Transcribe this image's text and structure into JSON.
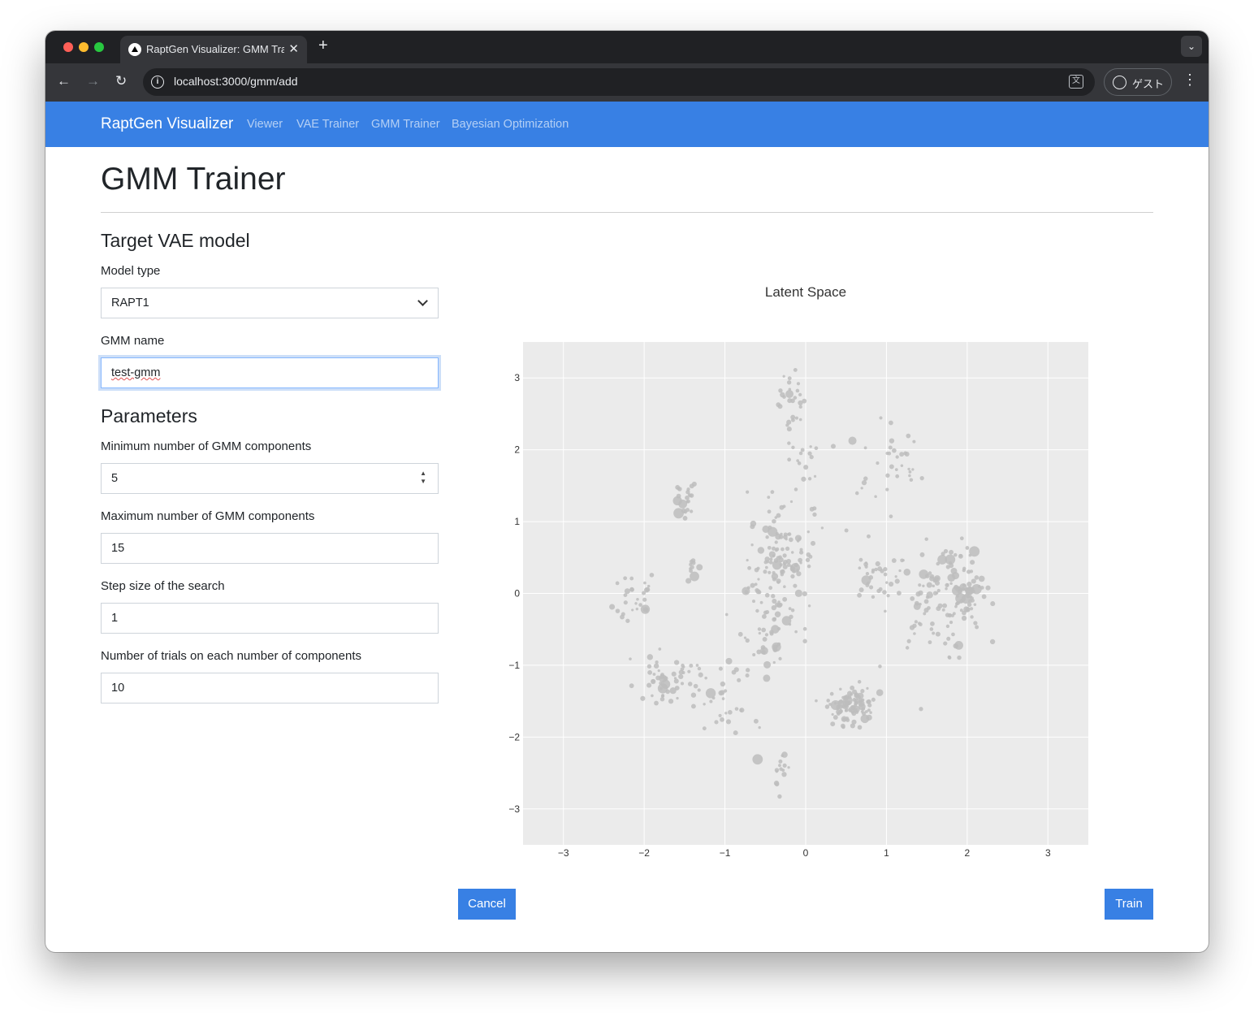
{
  "browser": {
    "tab_title": "RaptGen Visualizer: GMM Trainer",
    "new_tab": "+",
    "tab_close": "✕",
    "url": "localhost:3000/gmm/add",
    "profile_label": "ゲスト"
  },
  "navbar": {
    "brand": "RaptGen Visualizer",
    "links": [
      "Viewer",
      "VAE Trainer",
      "GMM Trainer",
      "Bayesian Optimization"
    ]
  },
  "page": {
    "title": "GMM Trainer",
    "target_section": "Target VAE model",
    "model_type_label": "Model type",
    "model_type_value": "RAPT1",
    "gmm_name_label": "GMM name",
    "gmm_name_value": "test-gmm",
    "params_section": "Parameters",
    "min_label": "Minimum number of GMM components",
    "min_value": "5",
    "max_label": "Maximum number of GMM components",
    "max_value": "15",
    "step_label": "Step size of the search",
    "step_value": "1",
    "trials_label": "Number of trials on each number of components",
    "trials_value": "10"
  },
  "actions": {
    "cancel": "Cancel",
    "train": "Train"
  },
  "colors": {
    "navbar": "#3880e4",
    "button": "#3880e4",
    "plot_bg": "#ebebeb",
    "point": "#bdbdbd"
  },
  "chart_data": {
    "type": "scatter",
    "title": "Latent Space",
    "xlabel": "",
    "ylabel": "",
    "xlim": [
      -3.5,
      3.5
    ],
    "ylim": [
      -3.5,
      3.5
    ],
    "xticks": [
      -3,
      -2,
      -1,
      0,
      1,
      2,
      3
    ],
    "yticks": [
      -3,
      -2,
      -1,
      0,
      1,
      2,
      3
    ],
    "grid": true,
    "clusters": [
      {
        "cx": -0.18,
        "cy": 2.65,
        "sx": 0.08,
        "sy": 0.3,
        "n": 30
      },
      {
        "cx": -0.02,
        "cy": 1.9,
        "sx": 0.1,
        "sy": 0.15,
        "n": 10
      },
      {
        "cx": 1.15,
        "cy": 1.75,
        "sx": 0.15,
        "sy": 0.25,
        "n": 25
      },
      {
        "cx": 0.6,
        "cy": 1.5,
        "sx": 0.35,
        "sy": 0.5,
        "n": 18
      },
      {
        "cx": -1.5,
        "cy": 1.3,
        "sx": 0.08,
        "sy": 0.15,
        "n": 22
      },
      {
        "cx": -0.3,
        "cy": 0.4,
        "sx": 0.2,
        "sy": 0.45,
        "n": 130
      },
      {
        "cx": -0.5,
        "cy": -0.55,
        "sx": 0.15,
        "sy": 0.3,
        "n": 35
      },
      {
        "cx": 0.8,
        "cy": 0.2,
        "sx": 0.15,
        "sy": 0.15,
        "n": 25
      },
      {
        "cx": 1.6,
        "cy": 0.0,
        "sx": 0.3,
        "sy": 0.4,
        "n": 110
      },
      {
        "cx": 2.0,
        "cy": 0.1,
        "sx": 0.15,
        "sy": 0.25,
        "n": 45
      },
      {
        "cx": -1.45,
        "cy": 0.35,
        "sx": 0.1,
        "sy": 0.06,
        "n": 10
      },
      {
        "cx": -2.1,
        "cy": 0.05,
        "sx": 0.12,
        "sy": 0.2,
        "n": 28
      },
      {
        "cx": -1.75,
        "cy": -1.2,
        "sx": 0.22,
        "sy": 0.18,
        "n": 50
      },
      {
        "cx": -1.0,
        "cy": -1.55,
        "sx": 0.2,
        "sy": 0.35,
        "n": 35
      },
      {
        "cx": 0.55,
        "cy": -1.55,
        "sx": 0.14,
        "sy": 0.14,
        "n": 95
      },
      {
        "cx": -0.3,
        "cy": -2.45,
        "sx": 0.05,
        "sy": 0.12,
        "n": 14
      }
    ]
  }
}
